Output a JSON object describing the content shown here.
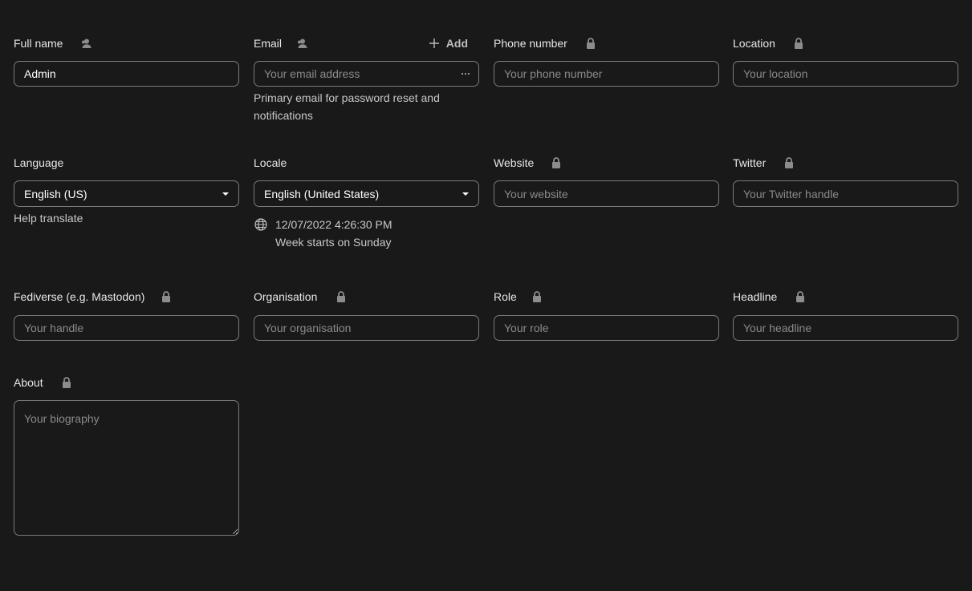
{
  "fields": {
    "full_name": {
      "label": "Full name",
      "value": "Admin",
      "scope_icon": "account-group-icon"
    },
    "email": {
      "label": "Email",
      "placeholder": "Your email address",
      "add_label": "Add",
      "hint": "Primary email for password reset and notifications",
      "scope_icon": "account-group-icon"
    },
    "phone": {
      "label": "Phone number",
      "placeholder": "Your phone number",
      "scope_icon": "lock-icon"
    },
    "location": {
      "label": "Location",
      "placeholder": "Your location",
      "scope_icon": "lock-icon"
    },
    "language": {
      "label": "Language",
      "value": "English (US)",
      "hint": "Help translate"
    },
    "locale": {
      "label": "Locale",
      "value": "English (United States)",
      "datetime": "12/07/2022 4:26:30 PM",
      "week_start": "Week starts on Sunday"
    },
    "website": {
      "label": "Website",
      "placeholder": "Your website",
      "scope_icon": "lock-icon"
    },
    "twitter": {
      "label": "Twitter",
      "placeholder": "Your Twitter handle",
      "scope_icon": "lock-icon"
    },
    "fediverse": {
      "label": "Fediverse (e.g. Mastodon)",
      "placeholder": "Your handle",
      "scope_icon": "lock-icon"
    },
    "organisation": {
      "label": "Organisation",
      "placeholder": "Your organisation",
      "scope_icon": "lock-icon"
    },
    "role": {
      "label": "Role",
      "placeholder": "Your role",
      "scope_icon": "lock-icon"
    },
    "headline": {
      "label": "Headline",
      "placeholder": "Your headline",
      "scope_icon": "lock-icon"
    },
    "about": {
      "label": "About",
      "placeholder": "Your biography",
      "scope_icon": "lock-icon"
    }
  },
  "colors": {
    "background": "#191919",
    "border": "#7a7a7a",
    "text": "#e6e6e6",
    "placeholder": "#8a8a8a",
    "icon": "#8c8c8c"
  }
}
